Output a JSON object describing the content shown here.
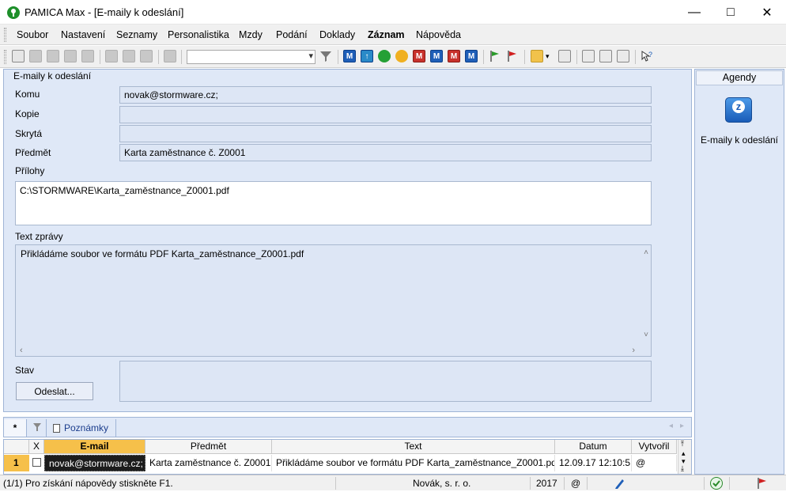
{
  "window": {
    "title": "PAMICA Max - [E-maily k odeslání]"
  },
  "menu": [
    "Soubor",
    "Nastavení",
    "Seznamy",
    "Personalistika",
    "Mzdy",
    "Podání",
    "Doklady",
    "Záznam",
    "Nápověda"
  ],
  "toolbar": {
    "combo_value": ""
  },
  "form": {
    "section_title": "E-maily k odeslání",
    "komu_label": "Komu",
    "komu_value": "novak@stormware.cz;",
    "kopie_label": "Kopie",
    "kopie_value": "",
    "skryta_label": "Skrytá",
    "skryta_value": "",
    "predmet_label": "Předmět",
    "predmet_value": "Karta zaměstnance č. Z0001",
    "prilohy_label": "Přílohy",
    "prilohy_value": "C:\\STORMWARE\\Karta_zaměstnance_Z0001.pdf",
    "text_label": "Text zprávy",
    "text_value": "Přikládáme soubor ve formátu PDF Karta_zaměstnance_Z0001.pdf",
    "stav_label": "Stav",
    "stav_value": "",
    "send_button": "Odeslat..."
  },
  "agendy": {
    "header": "Agendy",
    "item_label": "E-maily k odeslání"
  },
  "tabs": {
    "star": "*",
    "notes": "Poznámky"
  },
  "grid": {
    "columns": [
      "X",
      "E-mail",
      "Předmět",
      "Text",
      "Datum",
      "Vytvořil"
    ],
    "rows": [
      {
        "num": "1",
        "email": "novak@stormware.cz;",
        "subject": "Karta zaměstnance č. Z0001",
        "text": "Přikládáme soubor ve formátu PDF Karta_zaměstnance_Z0001.pdf",
        "date": "12.09.17 12:10:5",
        "created_by": "@"
      }
    ]
  },
  "status": {
    "help": "(1/1) Pro získání nápovědy stiskněte F1.",
    "company": "Novák, s. r. o.",
    "year": "2017",
    "at": "@"
  },
  "colors": {
    "accent": "#1f5fb8",
    "panel_bg": "#dfe8f7",
    "active_header": "#f6c04a"
  }
}
